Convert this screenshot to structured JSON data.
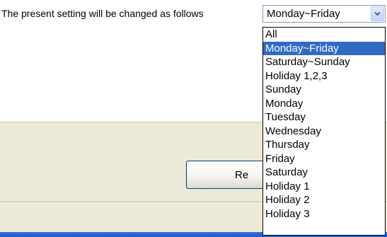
{
  "message": {
    "text": "The present setting will be changed as follows"
  },
  "day_select": {
    "value": "Monday~Friday",
    "options": [
      "All",
      "Monday~Friday",
      "Saturday~Sunday",
      "Holiday 1,2,3",
      "Sunday",
      "Monday",
      "Tuesday",
      "Wednesday",
      "Thursday",
      "Friday",
      "Saturday",
      "Holiday 1",
      "Holiday 2",
      "Holiday 3"
    ],
    "highlighted_option": "Monday~Friday"
  },
  "buttons": {
    "reset_label_partial": "Re"
  },
  "icons": {
    "dropdown": "chevron-down-icon"
  },
  "colors": {
    "selection_highlight": "#316ac5",
    "panel_background": "#ece9d8",
    "taskbar": "#2456c6"
  }
}
